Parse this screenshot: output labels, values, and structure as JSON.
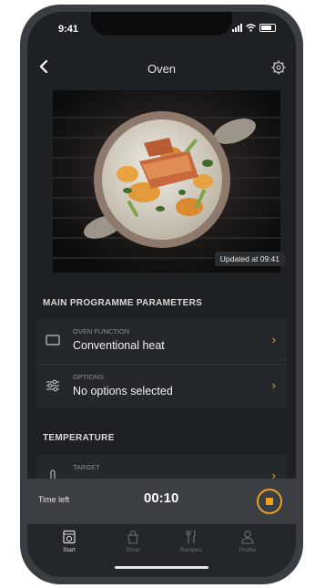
{
  "status_bar": {
    "time": "9:41"
  },
  "header": {
    "back_label": "<",
    "title": "Oven"
  },
  "camera": {
    "updated_text": "Updated at 09:41"
  },
  "sections": {
    "main": {
      "heading": "MAIN PROGRAMME PARAMETERS"
    },
    "temperature": {
      "heading": "TEMPERATURE"
    }
  },
  "rows": {
    "oven_function": {
      "caption": "OVEN FUNCTION",
      "value": "Conventional heat"
    },
    "options": {
      "caption": "OPTIONS",
      "value": "No options selected"
    },
    "target": {
      "caption": "TARGET"
    }
  },
  "timer": {
    "label": "Time left",
    "value": "00:10"
  },
  "tabs": [
    {
      "label": "Start",
      "icon": "oven-icon",
      "active": true
    },
    {
      "label": "Shop",
      "icon": "shop-bag-icon",
      "active": false
    },
    {
      "label": "Recipes",
      "icon": "recipes-icon",
      "active": false
    },
    {
      "label": "Profile",
      "icon": "profile-icon",
      "active": false
    }
  ],
  "colors": {
    "accent": "#f0a020",
    "background": "#1e2124",
    "row": "#24282b"
  }
}
